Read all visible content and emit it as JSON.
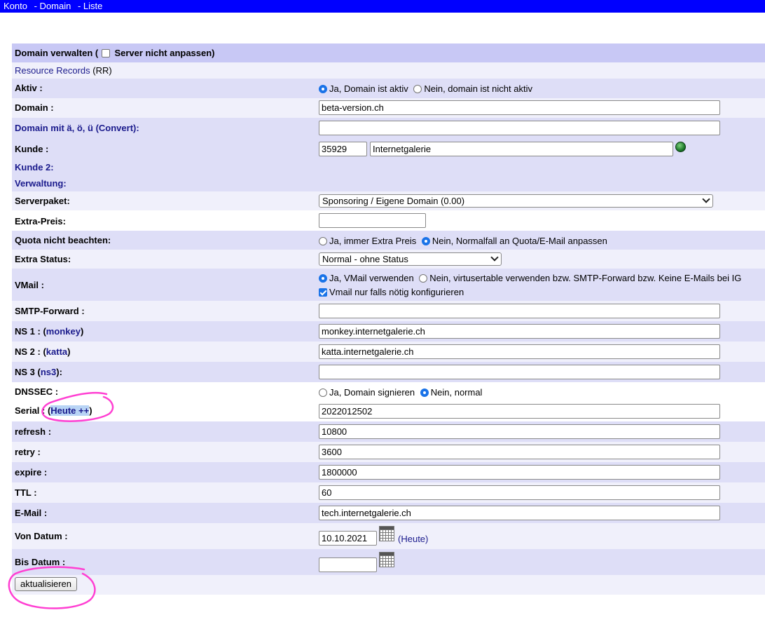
{
  "nav": {
    "konto": "Konto",
    "domain": "- Domain",
    "liste": "- Liste"
  },
  "header": {
    "title_prefix": "Domain verwalten (",
    "checkbox_label": "Server nicht anpassen)"
  },
  "resource_records": {
    "link": "Resource Records",
    "suffix": "(RR)"
  },
  "fields": {
    "aktiv": {
      "label": "Aktiv :",
      "opt_yes": "Ja, Domain ist aktiv",
      "opt_no": "Nein, domain ist nicht aktiv",
      "selected": "yes"
    },
    "domain": {
      "label": "Domain :",
      "value": "beta-version.ch"
    },
    "domain_idn": {
      "label_prefix": "Domain mit ä, ö, ü (",
      "link": "Convert",
      "label_suffix": "):",
      "value": ""
    },
    "kunde": {
      "label": "Kunde :",
      "id": "35929",
      "name": "Internetgalerie"
    },
    "kunde2": {
      "label": "Kunde 2:"
    },
    "verwaltung": {
      "label": "Verwaltung:"
    },
    "serverpaket": {
      "label": "Serverpaket:",
      "value": "Sponsoring / Eigene Domain (0.00)"
    },
    "extra_preis": {
      "label": "Extra-Preis:",
      "value": ""
    },
    "quota": {
      "label": "Quota nicht beachten:",
      "opt_yes": "Ja, immer Extra Preis",
      "opt_no": "Nein, Normalfall an Quota/E-Mail anpassen",
      "selected": "no"
    },
    "extra_status": {
      "label": "Extra Status:",
      "value": "Normal - ohne Status"
    },
    "vmail": {
      "label": "VMail :",
      "opt_yes": "Ja, VMail verwenden",
      "opt_no": "Nein, virtusertable verwenden bzw. SMTP-Forward bzw. Keine E-Mails bei IG",
      "check_label": "Vmail nur falls nötig konfigurieren",
      "selected": "yes",
      "checked": true
    },
    "smtp_forward": {
      "label": "SMTP-Forward :",
      "value": ""
    },
    "ns1": {
      "label_prefix": "NS 1 : (",
      "link": "monkey",
      "label_suffix": ")",
      "value": "monkey.internetgalerie.ch"
    },
    "ns2": {
      "label_prefix": "NS 2 : (",
      "link": "katta",
      "label_suffix": ")",
      "value": "katta.internetgalerie.ch"
    },
    "ns3": {
      "label_prefix": "NS 3 (",
      "link": "ns3",
      "label_suffix": "):",
      "value": ""
    },
    "dnssec": {
      "label": "DNSSEC :",
      "opt_yes": "Ja, Domain signieren",
      "opt_no": "Nein, normal",
      "selected": "no"
    },
    "serial": {
      "label_prefix": "Serial : (",
      "link": "Heute ++",
      "label_suffix": ")",
      "value": "2022012502"
    },
    "refresh": {
      "label": "refresh :",
      "value": "10800"
    },
    "retry": {
      "label": "retry :",
      "value": "3600"
    },
    "expire": {
      "label": "expire :",
      "value": "1800000"
    },
    "ttl": {
      "label": "TTL :",
      "value": "60"
    },
    "email": {
      "label": "E-Mail :",
      "value": "tech.internetgalerie.ch"
    },
    "von_datum": {
      "label": "Von Datum :",
      "value": "10.10.2021",
      "link_prefix": "(",
      "link": "Heute",
      "link_suffix": ")"
    },
    "bis_datum": {
      "label": "Bis Datum :",
      "value": ""
    }
  },
  "submit": {
    "label": "aktualisieren"
  },
  "colors": {
    "nav_bg": "#0000ff",
    "header_bg": "#c8c8f5",
    "row_dark": "#dedef7",
    "row_light": "#f0f0fb",
    "annotation": "#ff3fd2"
  }
}
